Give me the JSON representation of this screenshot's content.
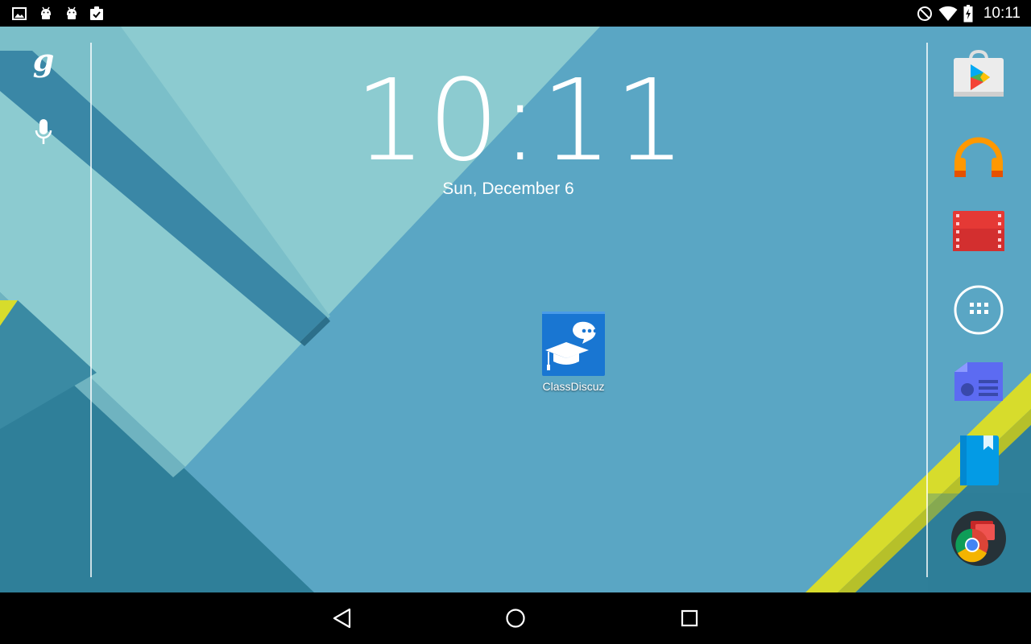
{
  "status_bar": {
    "left_icons": [
      "image-icon",
      "android-debug-icon",
      "android-debug-icon",
      "clipboard-check-icon"
    ],
    "right_icons": [
      "no-sim-icon",
      "wifi-icon",
      "battery-charging-icon"
    ],
    "time": "10:11"
  },
  "search": {
    "google_label": "g",
    "icons": [
      "google-icon",
      "microphone-icon"
    ]
  },
  "clock": {
    "time": "10:11",
    "date": "Sun, December 6"
  },
  "desktop": {
    "apps": [
      {
        "label": "ClassDiscuz",
        "icon": "graduation-cap-chat-icon",
        "color": "#1976d2"
      }
    ]
  },
  "dock": {
    "items": [
      {
        "name": "play-store-icon"
      },
      {
        "name": "play-music-icon"
      },
      {
        "name": "play-movies-icon"
      },
      {
        "name": "app-drawer-icon"
      },
      {
        "name": "newsstand-icon"
      },
      {
        "name": "play-books-icon"
      },
      {
        "name": "chrome-icon"
      }
    ]
  },
  "nav_bar": {
    "buttons": [
      "back-icon",
      "home-icon",
      "recents-icon"
    ]
  },
  "colors": {
    "wallpaper_base": "#5aa6c4",
    "wallpaper_light": "#8ccbd0",
    "wallpaper_dark": "#2e7d97",
    "accent_yellow": "#d7dc2c",
    "status_bar": "#000000"
  }
}
